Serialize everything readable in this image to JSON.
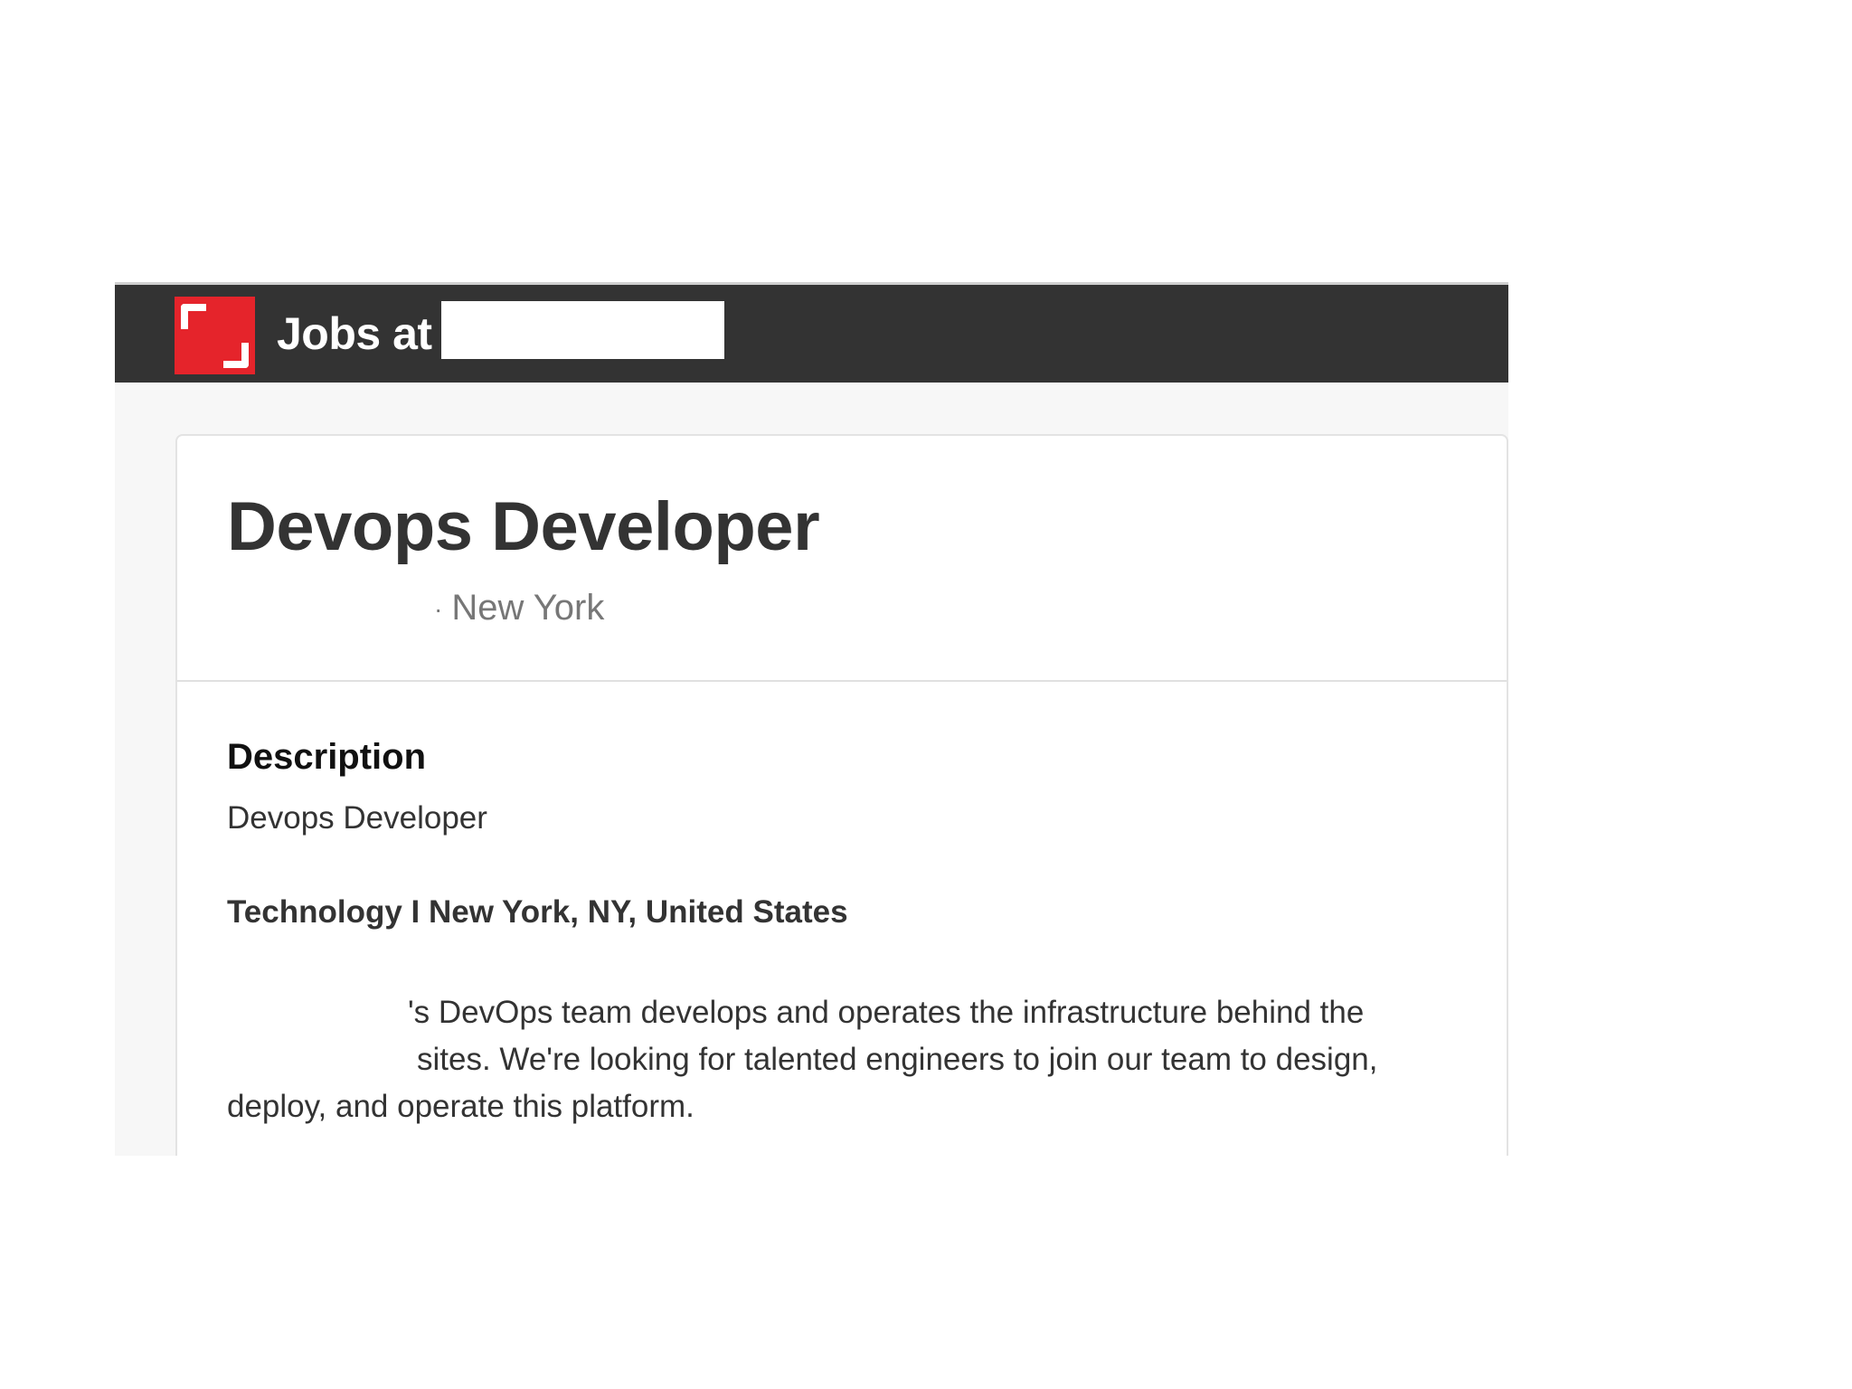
{
  "header": {
    "brand_label": "Jobs at"
  },
  "job": {
    "title": "Devops Developer",
    "location_separator": "·",
    "location": "New York"
  },
  "description": {
    "heading": "Description",
    "subtitle": "Devops Developer",
    "category_line": "Technology I New York, NY, United States",
    "paragraph_line1": "'s DevOps team develops and operates the infrastructure behind the",
    "paragraph_line2": "sites. We're looking for talented engineers to join our team to design,",
    "paragraph_line3": "deploy, and operate this platform."
  },
  "colors": {
    "topbar": "#333333",
    "logo_red": "#e5242b",
    "page_bg": "#f7f7f7",
    "text": "#333333",
    "muted": "#777777"
  }
}
